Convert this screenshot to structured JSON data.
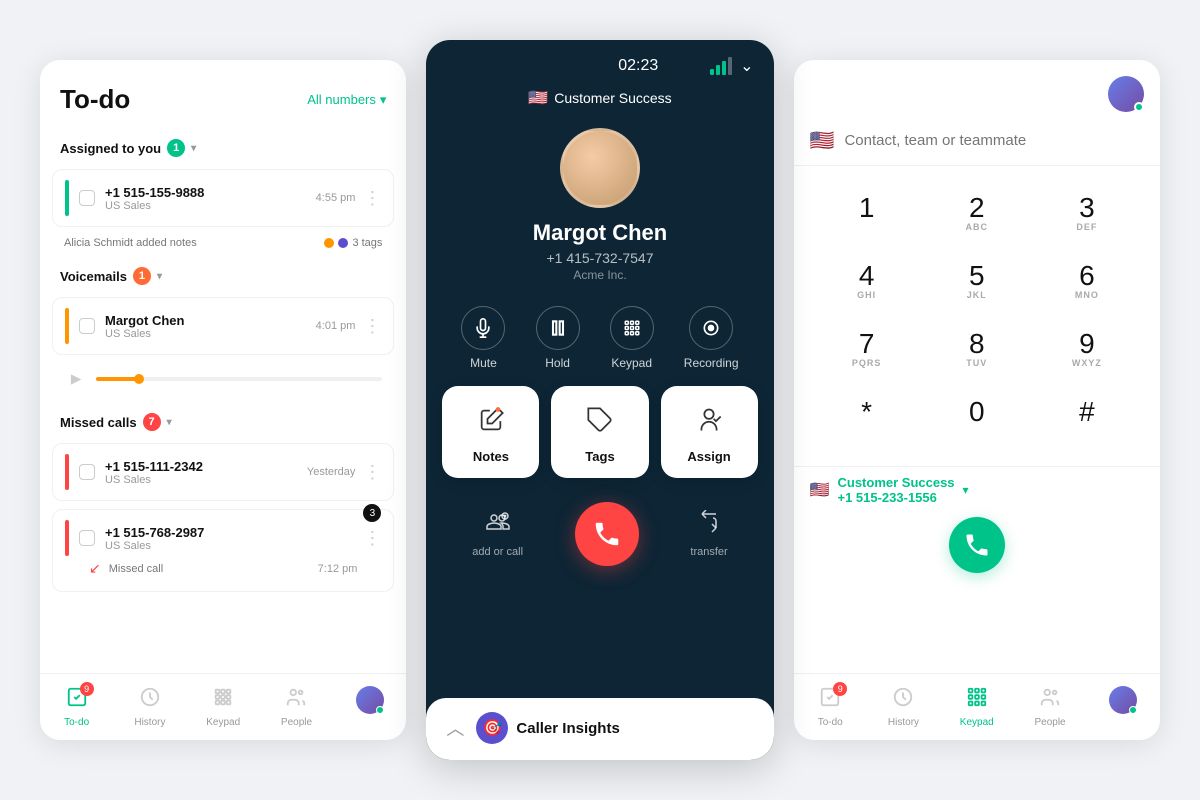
{
  "left_panel": {
    "title": "To-do",
    "all_numbers": "All numbers",
    "sections": {
      "assigned": {
        "label": "Assigned to you",
        "count": "1",
        "items": [
          {
            "number": "+1 515-155-9888",
            "sublabel": "US Sales",
            "time": "4:55 pm",
            "note": "Alicia Schmidt added notes",
            "tags": "3 tags"
          }
        ]
      },
      "voicemails": {
        "label": "Voicemails",
        "count": "1",
        "items": [
          {
            "name": "Margot Chen",
            "sublabel": "US Sales",
            "time": "4:01 pm"
          }
        ]
      },
      "missed": {
        "label": "Missed calls",
        "count": "7",
        "items": [
          {
            "number": "+1 515-111-2342",
            "sublabel": "US Sales",
            "time": "Yesterday"
          },
          {
            "number": "+1 515-768-2987",
            "sublabel": "US Sales",
            "time": "",
            "badge": "3",
            "missed_label": "Missed call",
            "missed_time": "7:12 pm"
          }
        ]
      }
    },
    "nav": {
      "items": [
        "To-do",
        "History",
        "Keypad",
        "People"
      ],
      "active": "To-do",
      "badge": "9"
    }
  },
  "center_panel": {
    "timer": "02:23",
    "team": "Customer Success",
    "caller": {
      "name": "Margot Chen",
      "phone": "+1 415-732-7547",
      "company": "Acme Inc."
    },
    "controls": [
      {
        "icon": "mute",
        "label": "Mute"
      },
      {
        "icon": "hold",
        "label": "Hold"
      },
      {
        "icon": "keypad",
        "label": "Keypad"
      },
      {
        "icon": "recording",
        "label": "Recording"
      }
    ],
    "actions": [
      {
        "icon": "notes",
        "label": "Notes"
      },
      {
        "icon": "tags",
        "label": "Tags"
      },
      {
        "icon": "assign",
        "label": "Assign"
      }
    ],
    "end_call_actions": [
      {
        "icon": "add_call",
        "label": "add or call"
      },
      {
        "icon": "transfer",
        "label": "transfer"
      }
    ],
    "caller_insights": "Caller Insights"
  },
  "right_panel": {
    "search_placeholder": "Contact, team or teammate",
    "keys": [
      {
        "num": "1",
        "sub": ""
      },
      {
        "num": "2",
        "sub": "ABC"
      },
      {
        "num": "3",
        "sub": "DEF"
      },
      {
        "num": "4",
        "sub": "GHI"
      },
      {
        "num": "5",
        "sub": "JKL"
      },
      {
        "num": "6",
        "sub": "MNO"
      },
      {
        "num": "7",
        "sub": "PQRS"
      },
      {
        "num": "8",
        "sub": "TUV"
      },
      {
        "num": "9",
        "sub": "WXYZ"
      },
      {
        "num": "*",
        "sub": ""
      },
      {
        "num": "0",
        "sub": ""
      },
      {
        "num": "#",
        "sub": ""
      }
    ],
    "selected_team": "Customer Success",
    "selected_phone": "+1 515-233-1556",
    "nav": {
      "items": [
        "To-do",
        "History",
        "Keypad",
        "People"
      ],
      "active": "Keypad",
      "badge": "9"
    }
  }
}
